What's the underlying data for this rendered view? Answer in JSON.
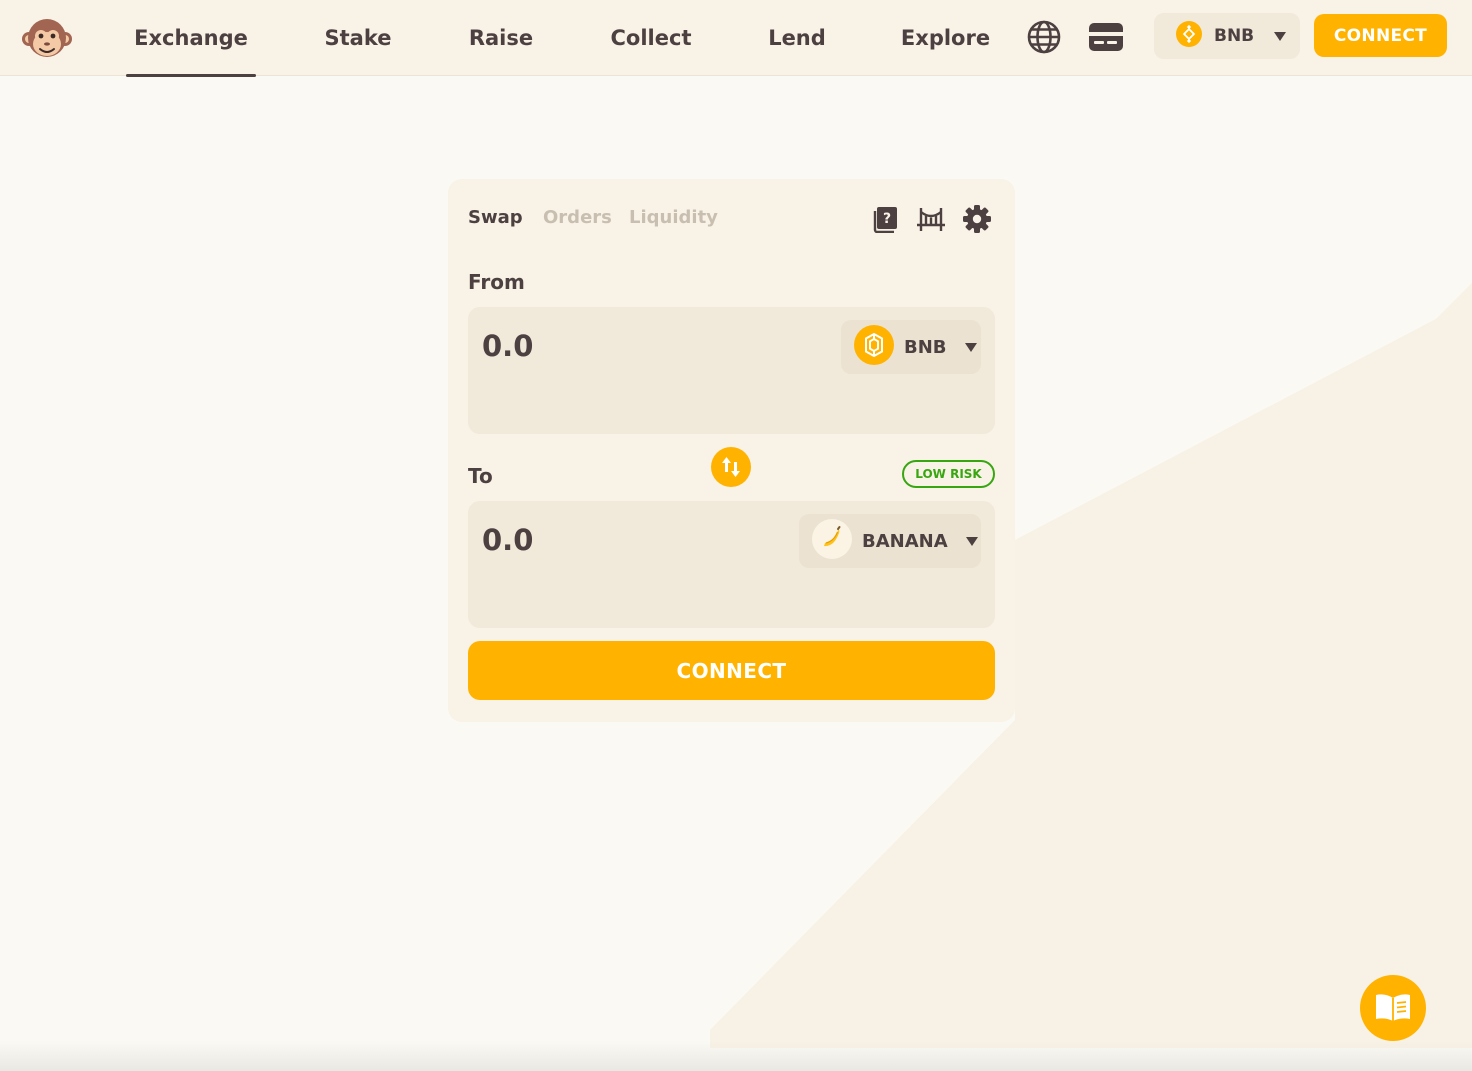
{
  "nav": {
    "items": [
      {
        "label": "Exchange",
        "active": true
      },
      {
        "label": "Stake",
        "active": false
      },
      {
        "label": "Raise",
        "active": false
      },
      {
        "label": "Collect",
        "active": false
      },
      {
        "label": "Lend",
        "active": false
      },
      {
        "label": "Explore",
        "active": false
      }
    ],
    "chain_label": "BNB",
    "connect_label": "CONNECT",
    "icons": [
      "monkey-logo-icon",
      "globe-icon",
      "card-icon",
      "bnb-icon",
      "chevron-down-icon"
    ]
  },
  "swap": {
    "tabs": [
      {
        "label": "Swap",
        "active": true
      },
      {
        "label": "Orders",
        "active": false
      },
      {
        "label": "Liquidity",
        "active": false
      }
    ],
    "tools": [
      "help-book-icon",
      "bridge-icon",
      "gear-icon"
    ],
    "from": {
      "label": "From",
      "amount_placeholder": "0.0",
      "token": "BNB"
    },
    "to": {
      "label": "To",
      "amount_placeholder": "0.0",
      "token": "BANANA"
    },
    "risk_badge": "LOW RISK",
    "connect_label": "CONNECT"
  },
  "colors": {
    "accent": "#ffb300",
    "text": "#4d4040",
    "panel": "#f1e9da",
    "card": "#f8f2e7",
    "background": "#fbf9f3",
    "risk_green": "#38a611",
    "inactive_tab": "#c9bfb1"
  }
}
